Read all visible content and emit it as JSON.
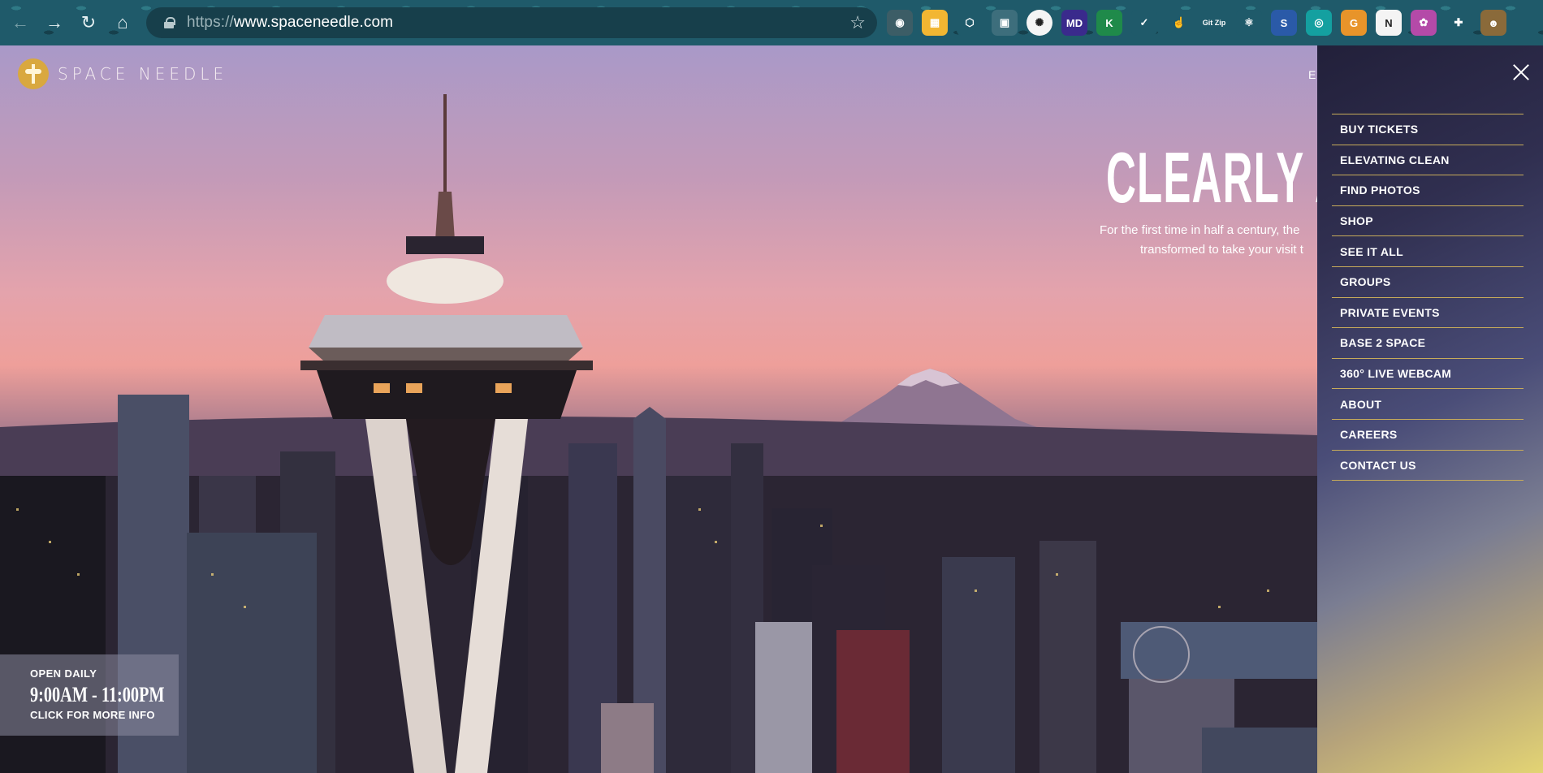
{
  "browser": {
    "url_scheme": "https://",
    "url_host": "www.spaceneedle.com",
    "extensions": [
      {
        "name": "camera-extension-icon",
        "glyph": "◉",
        "bg": "#3c5d66"
      },
      {
        "name": "sheets-extension-icon",
        "glyph": "▦",
        "bg": "#f2b632"
      },
      {
        "name": "cube-extension-icon",
        "glyph": "⬡",
        "bg": "#1f5a6a"
      },
      {
        "name": "image-extension-icon",
        "glyph": "▣",
        "bg": "#3d6e7c"
      },
      {
        "name": "gear-extension-icon",
        "glyph": "✺",
        "bg": "#f5f5f5"
      },
      {
        "name": "markdown-extension-icon",
        "glyph": "MD",
        "bg": "#3a2a8c"
      },
      {
        "name": "k-extension-icon",
        "glyph": "K",
        "bg": "#1f8a4a"
      },
      {
        "name": "check-extension-icon",
        "glyph": "✓",
        "bg": "#1f5a6a"
      },
      {
        "name": "hand-extension-icon",
        "glyph": "☝",
        "bg": "#1f5a6a"
      },
      {
        "name": "gitzip-extension-icon",
        "glyph": "Git Zip",
        "bg": "#1f5a6a"
      },
      {
        "name": "react-extension-icon",
        "glyph": "⚛",
        "bg": "#1f5a6a"
      },
      {
        "name": "s-extension-icon",
        "glyph": "S",
        "bg": "#2a5aa8"
      },
      {
        "name": "target-extension-icon",
        "glyph": "◎",
        "bg": "#14a0a0"
      },
      {
        "name": "g-extension-icon",
        "glyph": "G",
        "bg": "#e8942a"
      },
      {
        "name": "notion-extension-icon",
        "glyph": "N",
        "bg": "#f4f4f4"
      },
      {
        "name": "color-wheel-extension-icon",
        "glyph": "✿",
        "bg": "#b44aa8"
      },
      {
        "name": "puzzle-extension-icon",
        "glyph": "✚",
        "bg": "#1f5a6a"
      },
      {
        "name": "profile-avatar-icon",
        "glyph": "☻",
        "bg": "#8a6a3a"
      }
    ]
  },
  "site": {
    "logo_text": "SPACE NEEDLE",
    "nav_peek": "E"
  },
  "hero": {
    "title": "CLEARLY AWE",
    "subtitle_line1": "For the first time in half a century, the",
    "subtitle_line2": "transformed to take your visit t"
  },
  "hours": {
    "open_label": "OPEN DAILY",
    "time": "9:00AM - 11:00PM",
    "more_label": "CLICK FOR MORE INFO"
  },
  "menu": {
    "items": [
      "BUY TICKETS",
      "ELEVATING CLEAN",
      "FIND PHOTOS",
      "SHOP",
      "SEE IT ALL",
      "GROUPS",
      "PRIVATE EVENTS",
      "BASE 2 SPACE",
      "360° LIVE WEBCAM",
      "ABOUT",
      "CAREERS",
      "CONTACT US"
    ]
  }
}
